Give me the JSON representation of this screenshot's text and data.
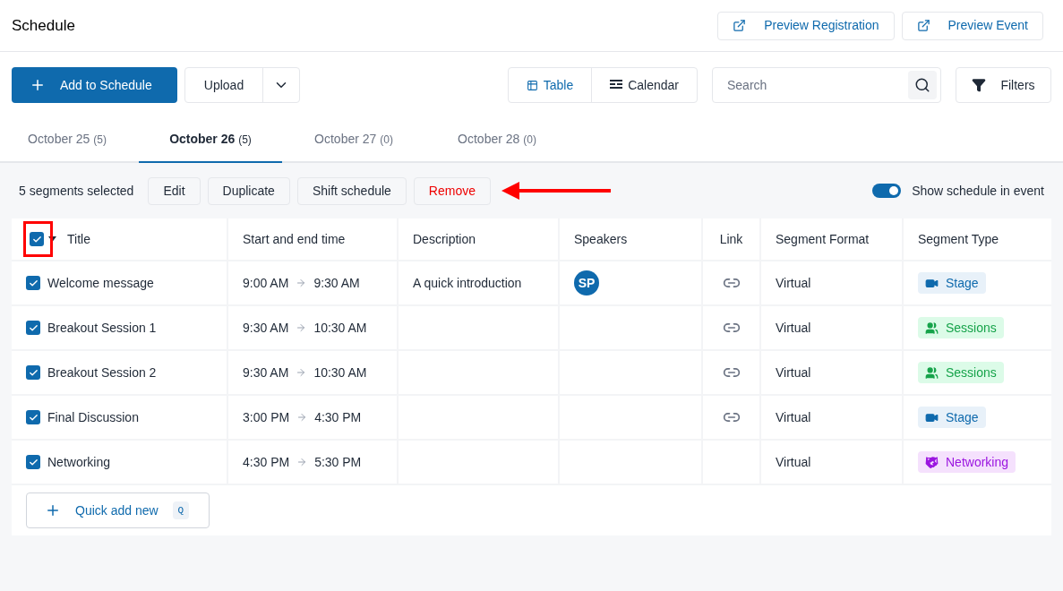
{
  "header": {
    "title": "Schedule",
    "actions": [
      "Preview Registration",
      "Preview Event"
    ]
  },
  "toolbar": {
    "add_button": "Add to Schedule",
    "upload_button": "Upload",
    "views": [
      {
        "label": "Table",
        "kind": "table",
        "selected": true
      },
      {
        "label": "Calendar",
        "kind": "calendar",
        "selected": false
      }
    ],
    "search": {
      "placeholder": "Search"
    },
    "filters_button": "Filters"
  },
  "tabs": [
    {
      "label": "October 25",
      "count": "(5)",
      "selected": false
    },
    {
      "label": "October 26",
      "count": "(5)",
      "selected": true
    },
    {
      "label": "October 27",
      "count": "(0)",
      "selected": false
    },
    {
      "label": "October 28",
      "count": "(0)",
      "selected": false
    }
  ],
  "selection_bar": {
    "summary": "5 segments selected",
    "actions": [
      {
        "label": "Edit",
        "kind": "normal"
      },
      {
        "label": "Duplicate",
        "kind": "normal"
      },
      {
        "label": "Shift schedule",
        "kind": "normal"
      },
      {
        "label": "Remove",
        "kind": "danger"
      }
    ],
    "toggle": {
      "label": "Show schedule in event",
      "on": true
    }
  },
  "table": {
    "select_all": {
      "checked": true
    },
    "columns": [
      "Title",
      "Start and end time",
      "Description",
      "Speakers",
      "Link",
      "Segment Format",
      "Segment Type"
    ],
    "rows": [
      {
        "checked": true,
        "title": "Welcome message",
        "start": "9:00 AM",
        "end": "9:30 AM",
        "description": "A quick introduction",
        "speakers": [
          "SP"
        ],
        "link": true,
        "format": "Virtual",
        "type": {
          "label": "Stage",
          "kind": "stage"
        }
      },
      {
        "checked": true,
        "title": "Breakout Session 1",
        "start": "9:30 AM",
        "end": "10:30 AM",
        "speakers": [],
        "link": true,
        "format": "Virtual",
        "type": {
          "label": "Sessions",
          "kind": "sessions"
        }
      },
      {
        "checked": true,
        "title": "Breakout Session 2",
        "start": "9:30 AM",
        "end": "10:30 AM",
        "speakers": [],
        "link": true,
        "format": "Virtual",
        "type": {
          "label": "Sessions",
          "kind": "sessions"
        }
      },
      {
        "checked": true,
        "title": "Final Discussion",
        "start": "3:00 PM",
        "end": "4:30 PM",
        "speakers": [],
        "link": true,
        "format": "Virtual",
        "type": {
          "label": "Stage",
          "kind": "stage"
        }
      },
      {
        "checked": true,
        "title": "Networking",
        "start": "4:30 PM",
        "end": "5:30 PM",
        "speakers": [],
        "link": false,
        "format": "Virtual",
        "type": {
          "label": "Networking",
          "kind": "networking"
        }
      }
    ],
    "quick_add": {
      "label": "Quick add new",
      "shortcut": "Q"
    }
  }
}
